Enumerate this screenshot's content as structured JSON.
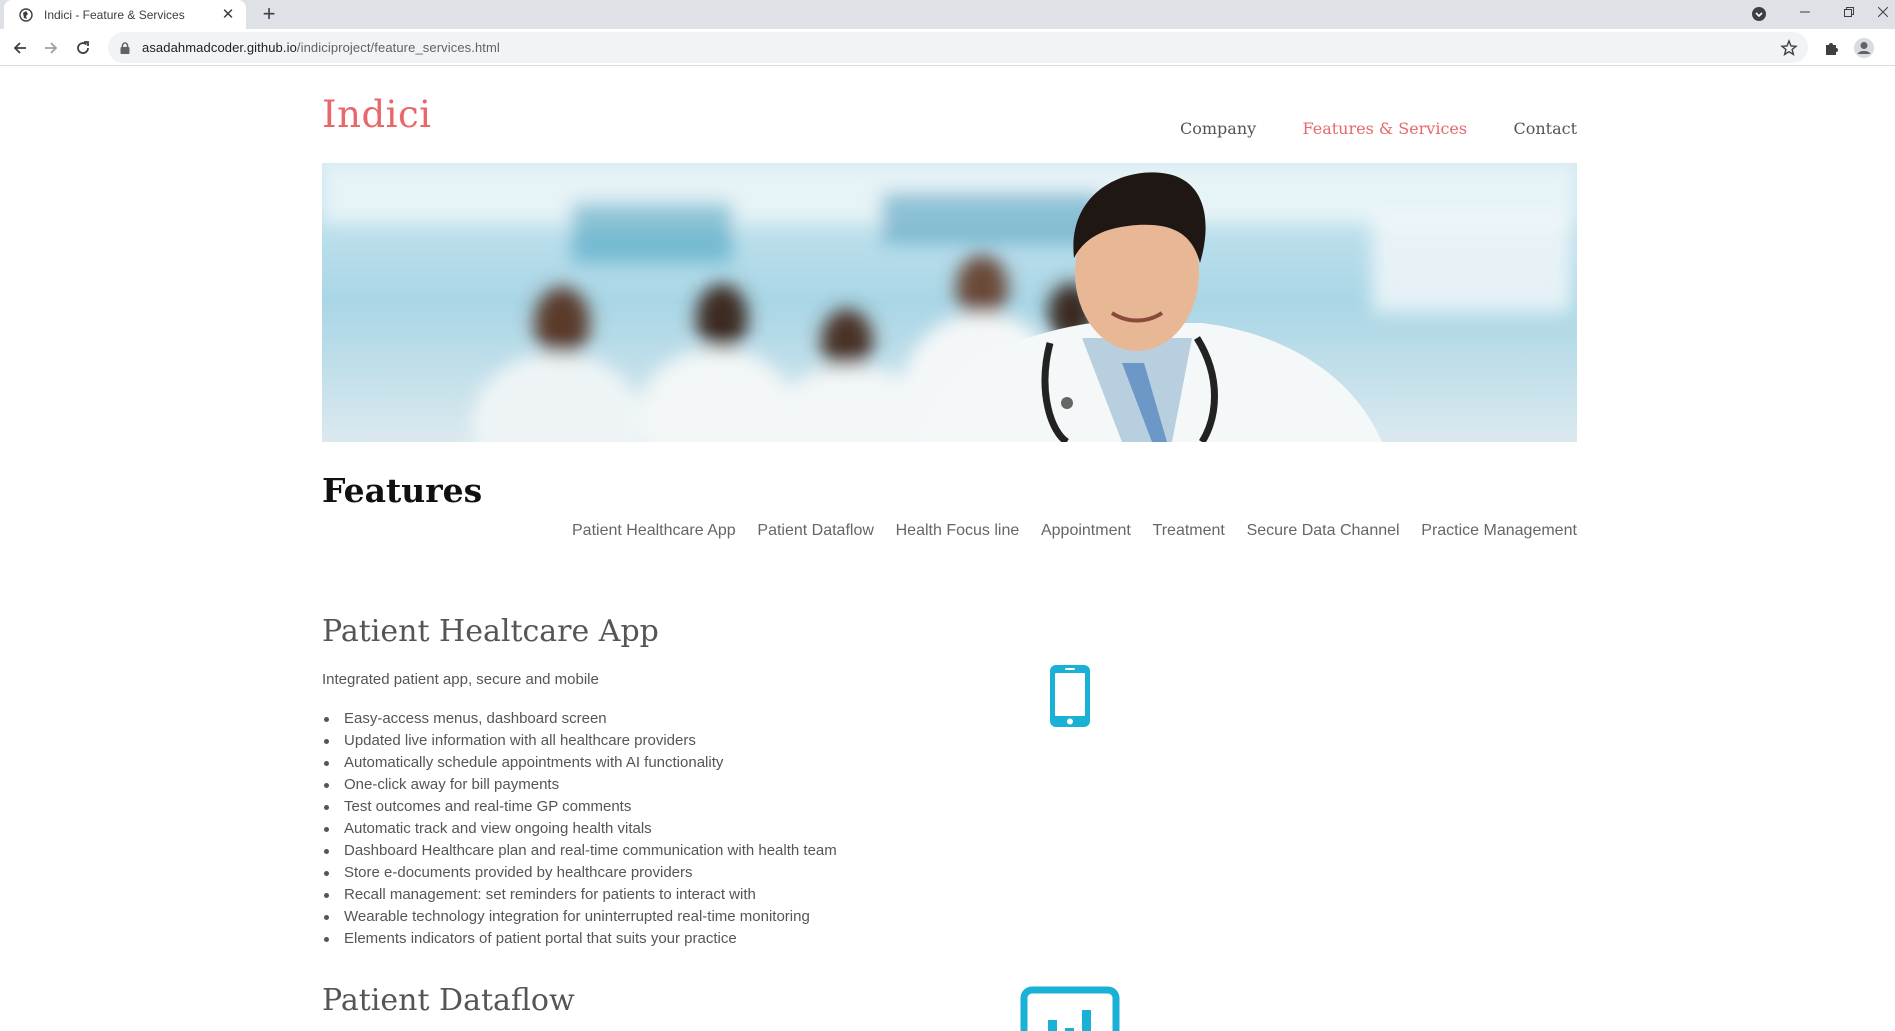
{
  "browser": {
    "tab_title": "Indici - Feature & Services",
    "tab_close": "✕",
    "new_tab": "+",
    "url_host": "asadahmadcoder.github.io",
    "url_path": "/indiciproject/feature_services.html"
  },
  "site": {
    "brand": "Indici",
    "nav": {
      "company": "Company",
      "features": "Features & Services",
      "contact": "Contact"
    },
    "accent_color": "#e8676b",
    "icon_color": "#1ab1d6"
  },
  "features": {
    "title": "Features",
    "subnav": {
      "item0": "Patient Healthcare App",
      "item1": "Patient Dataflow",
      "item2": "Health Focus line",
      "item3": "Appointment",
      "item4": "Treatment",
      "item5": "Secure Data Channel",
      "item6": "Practice Management"
    }
  },
  "sections": {
    "app": {
      "title": "Patient Healtcare App",
      "subtitle": "Integrated patient app, secure and mobile",
      "icon": "mobile-phone-icon",
      "items": {
        "i0": "Easy-access menus, dashboard screen",
        "i1": "Updated live information with all healthcare providers",
        "i2": "Automatically schedule appointments with AI functionality",
        "i3": "One-click away for bill payments",
        "i4": "Test outcomes and real-time GP comments",
        "i5": "Automatic track and view ongoing health vitals",
        "i6": "Dashboard Healthcare plan and real-time communication with health team",
        "i7": "Store e-documents provided by healthcare providers",
        "i8": "Recall management: set reminders for patients to interact with",
        "i9": "Wearable technology integration for uninterrupted real-time monitoring",
        "i10": "Elements indicators of patient portal that suits your practice"
      }
    },
    "dataflow": {
      "title": "Patient Dataflow",
      "icon": "bar-chart-icon"
    }
  }
}
